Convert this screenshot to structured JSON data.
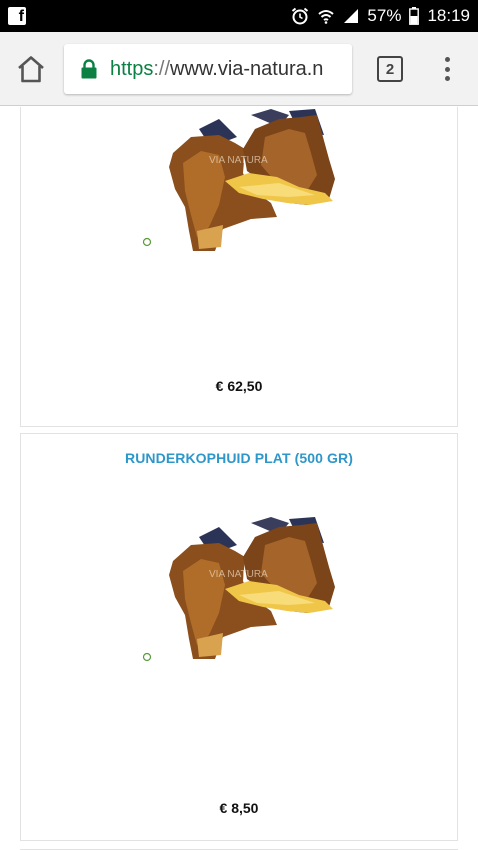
{
  "status_bar": {
    "battery": "57%",
    "time": "18:19",
    "icons": [
      "facebook-icon",
      "alarm-icon",
      "wifi-icon",
      "signal-icon",
      "battery-icon"
    ]
  },
  "browser": {
    "url_scheme": "https",
    "url_sep": "://",
    "url_host": "www.via-natura.n",
    "tab_count": "2",
    "icons": [
      "home-icon",
      "lock-icon",
      "tabs-icon",
      "more-vert-icon"
    ],
    "secure_color": "#0b8043"
  },
  "products": [
    {
      "title": "",
      "watermark": "VIA NATURA",
      "price": "€ 62,50"
    },
    {
      "title": "RUNDERKOPHUID PLAT (500 GR)",
      "watermark": "VIA NATURA",
      "price": "€ 8,50"
    }
  ],
  "colors": {
    "title_link": "#2e97c9",
    "status_bar_bg": "#000000",
    "toolbar_bg": "#f2f2f2"
  }
}
